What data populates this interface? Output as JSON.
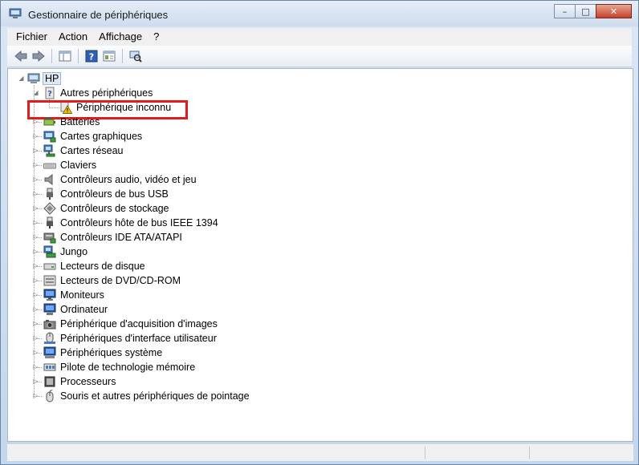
{
  "window": {
    "title": "Gestionnaire de périphériques",
    "controls": {
      "minimize": "–",
      "maximize": "□",
      "close": "✕"
    }
  },
  "menubar": [
    "Fichier",
    "Action",
    "Affichage",
    "?"
  ],
  "toolbar": {
    "buttons": [
      "back-arrow-icon",
      "forward-arrow-icon",
      "console-tree-icon",
      "help-icon",
      "properties-icon",
      "scan-hardware-icon"
    ]
  },
  "tree": {
    "root": {
      "label": "HP",
      "expanded": true,
      "icon": "computer-icon"
    },
    "other_devices": {
      "label": "Autres périphériques",
      "expanded": true,
      "icon": "unknown-device-icon"
    },
    "unknown_device": {
      "label": "Périphérique inconnu",
      "icon": "warning-device-icon",
      "highlighted": true
    },
    "categories": [
      {
        "label": "Batteries",
        "icon": "battery-icon"
      },
      {
        "label": "Cartes graphiques",
        "icon": "display-adapter-icon"
      },
      {
        "label": "Cartes réseau",
        "icon": "network-adapter-icon"
      },
      {
        "label": "Claviers",
        "icon": "keyboard-icon"
      },
      {
        "label": "Contrôleurs audio, vidéo et jeu",
        "icon": "speaker-icon"
      },
      {
        "label": "Contrôleurs de bus USB",
        "icon": "usb-plug-icon"
      },
      {
        "label": "Contrôleurs de stockage",
        "icon": "storage-controller-icon"
      },
      {
        "label": "Contrôleurs hôte de bus IEEE 1394",
        "icon": "firewire-plug-icon"
      },
      {
        "label": "Contrôleurs IDE ATA/ATAPI",
        "icon": "ide-controller-icon"
      },
      {
        "label": "Jungo",
        "icon": "jungo-icon"
      },
      {
        "label": "Lecteurs de disque",
        "icon": "disk-drive-icon"
      },
      {
        "label": "Lecteurs de DVD/CD-ROM",
        "icon": "dvd-drive-icon"
      },
      {
        "label": "Moniteurs",
        "icon": "monitor-icon"
      },
      {
        "label": "Ordinateur",
        "icon": "computer-icon"
      },
      {
        "label": "Périphérique d'acquisition d'images",
        "icon": "camera-icon"
      },
      {
        "label": "Périphériques d'interface utilisateur",
        "icon": "hid-icon"
      },
      {
        "label": "Périphériques système",
        "icon": "system-device-icon"
      },
      {
        "label": "Pilote de technologie mémoire",
        "icon": "memory-icon"
      },
      {
        "label": "Processeurs",
        "icon": "processor-icon"
      },
      {
        "label": "Souris et autres périphériques de pointage",
        "icon": "mouse-icon"
      }
    ]
  },
  "colors": {
    "highlight": "#e21b1b",
    "warning": "#f2c200"
  }
}
